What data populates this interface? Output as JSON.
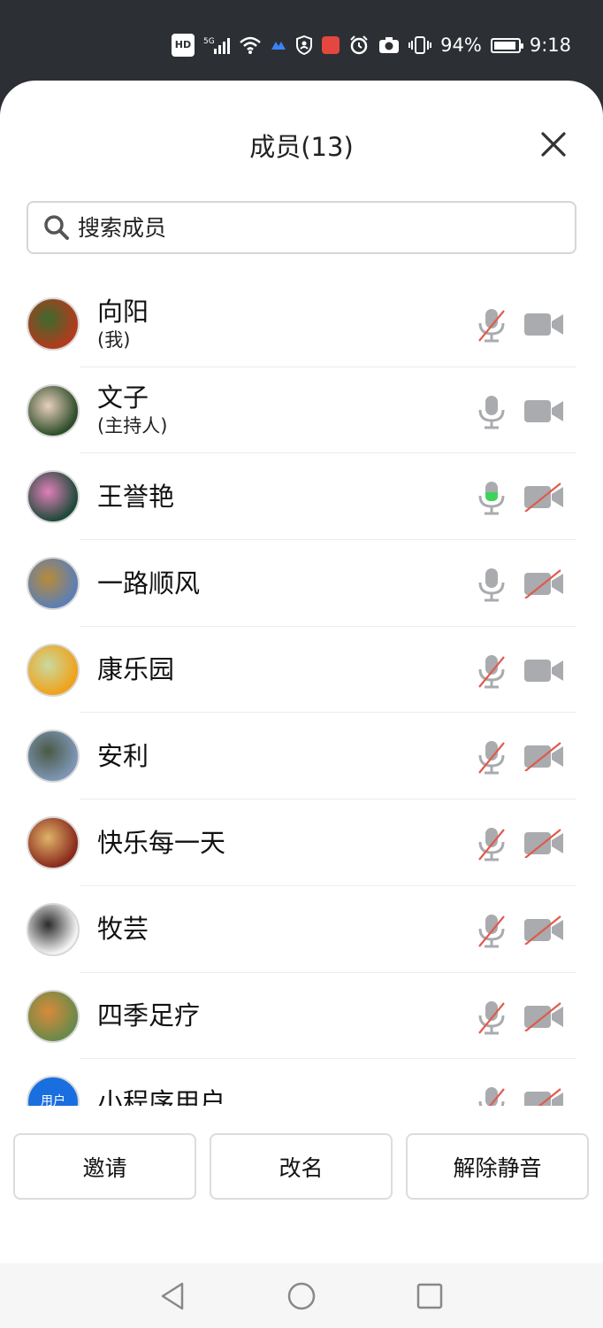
{
  "status_bar": {
    "badge_hd": "HD",
    "network": "5G",
    "battery_percent": "94%",
    "time": "9:18"
  },
  "sheet": {
    "title": "成员(13)",
    "search_placeholder": "搜索成员"
  },
  "members": [
    {
      "name": "向阳",
      "role": "(我)",
      "mic": "muted",
      "cam": "on",
      "avatar_colors": [
        "#b33a1c",
        "#3c6b2f"
      ]
    },
    {
      "name": "文子",
      "role": "(主持人)",
      "mic": "on",
      "cam": "on",
      "avatar_colors": [
        "#2f4d2a",
        "#e8d0bd"
      ]
    },
    {
      "name": "王誉艳",
      "role": "",
      "mic": "speaking",
      "cam": "off",
      "avatar_colors": [
        "#1f4a3a",
        "#e07fb9"
      ]
    },
    {
      "name": "一路顺风",
      "role": "",
      "mic": "on",
      "cam": "off",
      "avatar_colors": [
        "#5b7fb5",
        "#b98a3a"
      ]
    },
    {
      "name": "康乐园",
      "role": "",
      "mic": "muted",
      "cam": "on",
      "avatar_colors": [
        "#f0a21a",
        "#c9d9a0"
      ]
    },
    {
      "name": "安利",
      "role": "",
      "mic": "muted",
      "cam": "off",
      "avatar_colors": [
        "#7d96b5",
        "#4a5a45"
      ]
    },
    {
      "name": "快乐每一天",
      "role": "",
      "mic": "muted",
      "cam": "off",
      "avatar_colors": [
        "#8a2a1c",
        "#e0b36a"
      ]
    },
    {
      "name": "牧芸",
      "role": "",
      "mic": "muted",
      "cam": "off",
      "avatar_colors": [
        "#f4f4f4",
        "#2a2a2a"
      ]
    },
    {
      "name": "四季足疗",
      "role": "",
      "mic": "muted",
      "cam": "off",
      "avatar_colors": [
        "#6a8a4a",
        "#d98a3a"
      ]
    },
    {
      "name": "小程序用户",
      "role": "",
      "mic": "muted",
      "cam": "off",
      "avatar_colors": [
        "#1a6fe0",
        "#1a6fe0"
      ],
      "avatar_text": "用户"
    }
  ],
  "footer": {
    "invite_label": "邀请",
    "rename_label": "改名",
    "unmute_label": "解除静音"
  },
  "colors": {
    "icon_gray": "#a9abae",
    "muted_red": "#e05a4f",
    "speaking_green": "#3ed35a",
    "status_bar_bg": "#2c2f33"
  },
  "nav": {
    "back_icon": "back-triangle-icon",
    "home_icon": "home-circle-icon",
    "recents_icon": "recents-square-icon"
  }
}
